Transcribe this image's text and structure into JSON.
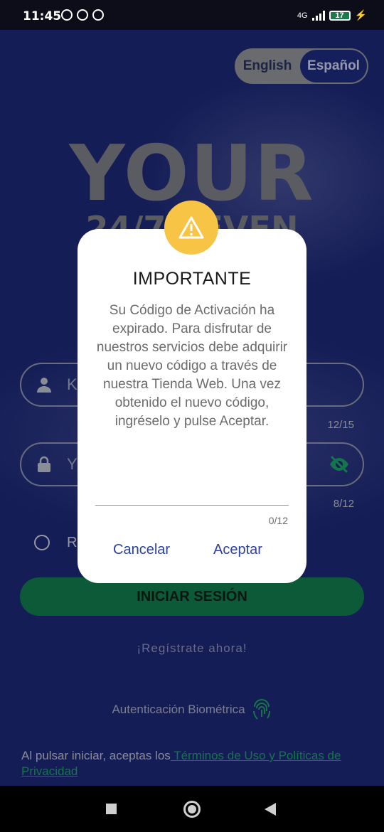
{
  "status_bar": {
    "time": "11:45",
    "network": "4G",
    "battery": "17",
    "icons": [
      "alarm-icon",
      "vpn-icon",
      "vpn-icon",
      "signal-icon",
      "battery-icon",
      "charging-icon"
    ]
  },
  "lang_toggle": {
    "options": [
      "English",
      "Español"
    ],
    "selected": "Español"
  },
  "hero": {
    "line1": "YOUR",
    "line2": "24/7 SEVEN"
  },
  "login": {
    "user_placeholder": "K",
    "user_counter": "12/15",
    "pass_placeholder": "Y",
    "pass_counter": "8/12",
    "remember_label": "R",
    "submit_label": "INICIAR SESIÓN",
    "register_link": "¡Regístrate ahora!",
    "biometric_label": "Autenticación Biométrica",
    "terms_prefix": "Al pulsar iniciar, aceptas los",
    "terms_link": " Términos de Uso y Políticas de Privacidad "
  },
  "dialog": {
    "title": "IMPORTANTE",
    "message": "Su Código de Activación ha expirado. Para disfrutar de nuestros servicios debe adquirir un nuevo código a través de nuestra Tienda Web. Una vez obtenido el nuevo código, ingréselo y pulse Aceptar.",
    "input_counter": "0/12",
    "cancel_label": "Cancelar",
    "accept_label": "Aceptar"
  },
  "colors": {
    "background": "#1c2773",
    "accent_green": "#10784a",
    "warning": "#f7c446",
    "dialog_button": "#2d3fa8"
  }
}
